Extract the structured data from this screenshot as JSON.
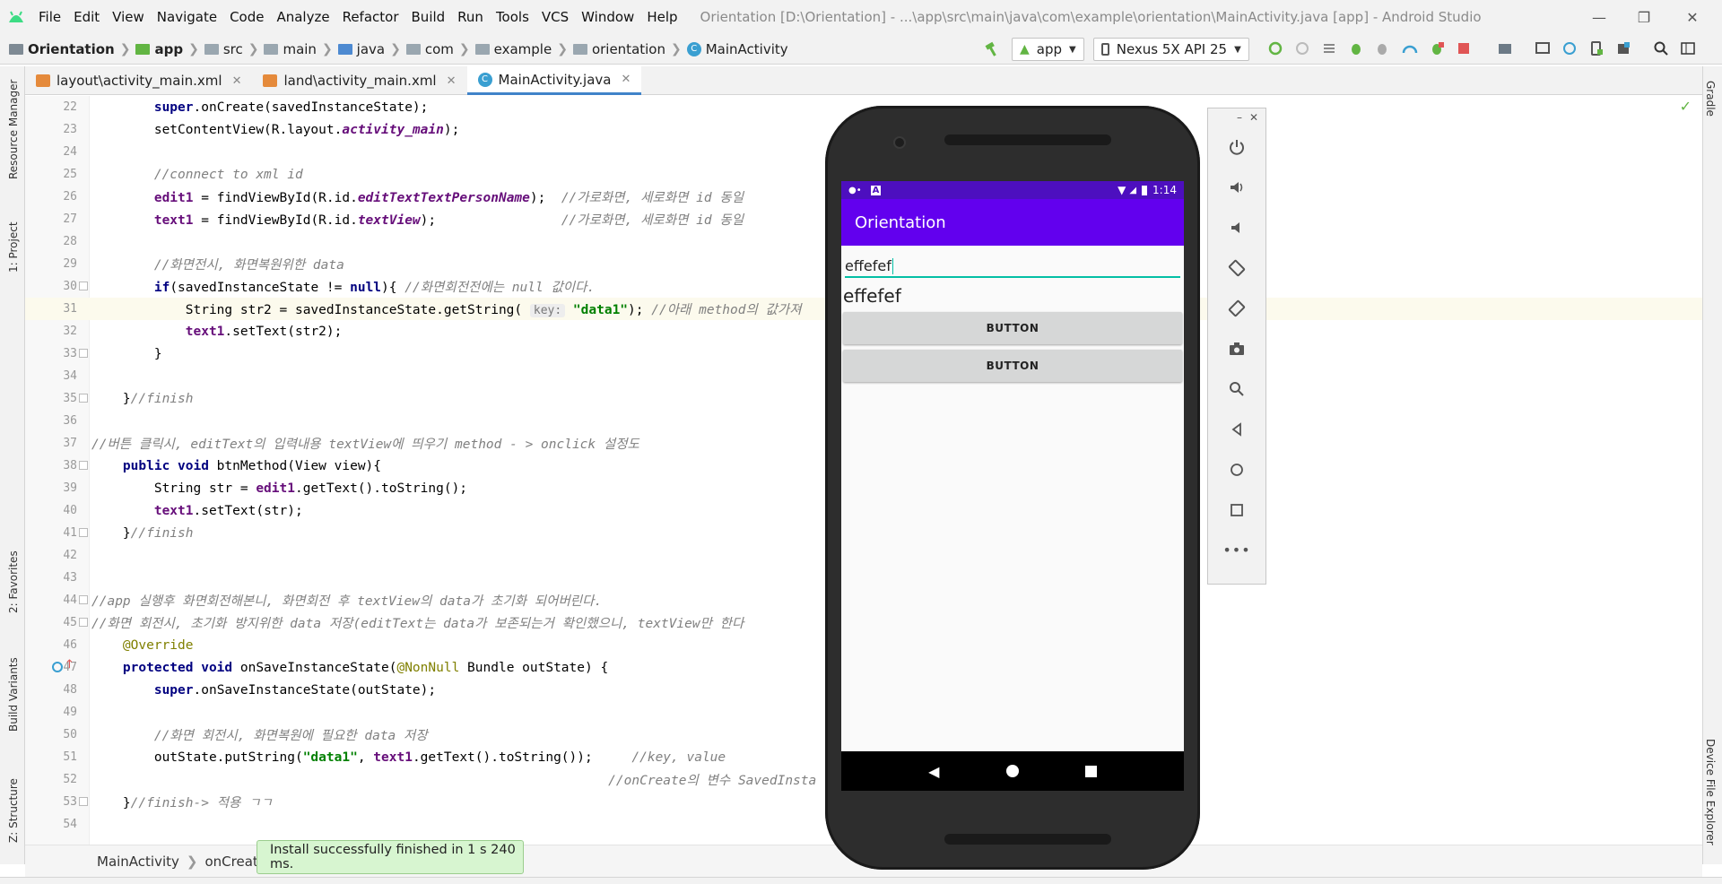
{
  "window": {
    "title": "Orientation [D:\\Orientation] - ...\\app\\src\\main\\java\\com\\example\\orientation\\MainActivity.java [app] - Android Studio",
    "menu": [
      "File",
      "Edit",
      "View",
      "Navigate",
      "Code",
      "Analyze",
      "Refactor",
      "Build",
      "Run",
      "Tools",
      "VCS",
      "Window",
      "Help"
    ]
  },
  "breadcrumb": [
    "Orientation",
    "app",
    "src",
    "main",
    "java",
    "com",
    "example",
    "orientation",
    "MainActivity"
  ],
  "toolbar": {
    "run_config": "app",
    "device": "Nexus 5X API 25"
  },
  "tabs": [
    {
      "label": "layout\\activity_main.xml"
    },
    {
      "label": "land\\activity_main.xml"
    },
    {
      "label": "MainActivity.java"
    }
  ],
  "side_left": [
    "Resource Manager",
    "1: Project",
    "2: Favorites",
    "Build Variants",
    "Z: Structure"
  ],
  "side_right": [
    "Gradle",
    "Device File Explorer"
  ],
  "code": {
    "line_numbers": [
      "22",
      "23",
      "24",
      "25",
      "26",
      "27",
      "28",
      "29",
      "30",
      "31",
      "32",
      "33",
      "34",
      "35",
      "36",
      "37",
      "38",
      "39",
      "40",
      "41",
      "42",
      "43",
      "44",
      "45",
      "46",
      "47",
      "48",
      "49",
      "50",
      "51",
      "52",
      "53",
      "54"
    ]
  },
  "editor_breadcrumb": [
    "MainActivity",
    "onCreate("
  ],
  "toast": "Install successfully finished in 1 s 240 ms.",
  "emulator": {
    "time": "1:14",
    "app_title": "Orientation",
    "edit_text": "effefef",
    "text_view": "effefef",
    "button1": "BUTTON",
    "button2": "BUTTON"
  },
  "colors": {
    "app_bar": "#6200ee",
    "status_bar": "#4d0fbf",
    "accent": "#03bfa5"
  }
}
